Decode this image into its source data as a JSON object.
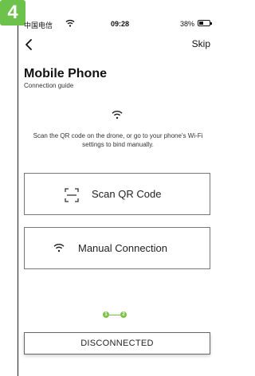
{
  "step_badge": "4",
  "status_bar": {
    "carrier": "中国电信",
    "time": "09:28",
    "battery": "38%"
  },
  "nav": {
    "skip_label": "Skip"
  },
  "header": {
    "title": "Mobile Phone",
    "subtitle": "Connection guide"
  },
  "instruction": "Scan the QR code on the drone, or go to your phone's Wi-Fi settings to bind manually.",
  "options": {
    "qr_label": "Scan QR Code",
    "manual_label": "Manual Connection"
  },
  "steps": {
    "step1": "1",
    "step2": "2",
    "color": "#7cc243"
  },
  "status_button": "DISCONNECTED",
  "colors": {
    "badge": "#6cc24a"
  },
  "icons": [
    "wifi-icon",
    "back-icon",
    "qr-scan-icon",
    "battery-icon"
  ]
}
